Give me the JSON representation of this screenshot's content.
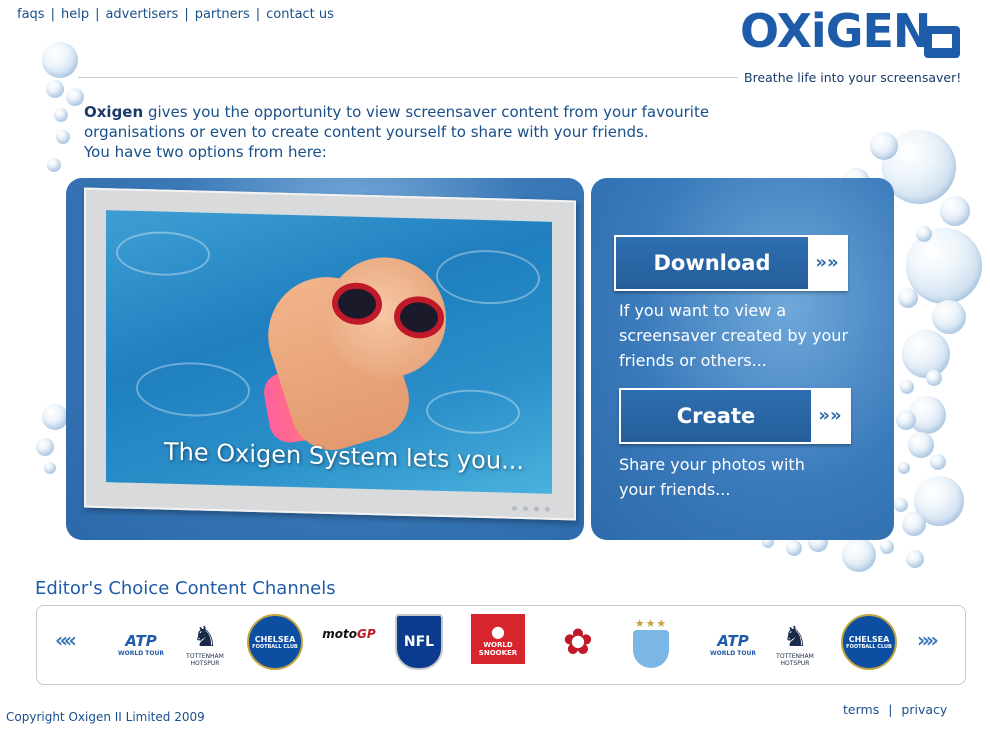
{
  "topnav": {
    "items": [
      "faqs",
      "help",
      "advertisers",
      "partners",
      "contact us"
    ],
    "separator": "|"
  },
  "logo": {
    "wordmark": "OXiGEN",
    "tagline": "Breathe life into your screensaver!"
  },
  "intro": {
    "brand": "Oxigen",
    "line1_rest": " gives you the opportunity to view screensaver content from your favourite",
    "line2": "organisations or even to create content yourself to share with your friends.",
    "line3": "You have two options from here:"
  },
  "feature": {
    "caption": "The Oxigen System lets you..."
  },
  "options": {
    "download": {
      "label": "Download",
      "arrow": "»»",
      "description": "If you want to view a screensaver created by your friends or others..."
    },
    "create": {
      "label": "Create",
      "arrow": "»»",
      "description": "Share your photos with your friends..."
    }
  },
  "channels": {
    "title": "Editor's Choice Content Channels",
    "prev": "«",
    "next": "»",
    "items": [
      {
        "name": "ATP",
        "sub": "WORLD TOUR"
      },
      {
        "name": "TOTTENHAM HOTSPUR"
      },
      {
        "name": "CHELSEA",
        "sub": "FOOTBALL CLUB"
      },
      {
        "name": "moto",
        "accent": "GP"
      },
      {
        "name": "NFL"
      },
      {
        "name": "WORLD SNOOKER"
      },
      {
        "name": "England Rugby"
      },
      {
        "name": "MCFC",
        "stars": "★★★"
      },
      {
        "name": "ATP",
        "sub": "WORLD TOUR"
      },
      {
        "name": "TOTTENHAM HOTSPUR"
      },
      {
        "name": "CHELSEA",
        "sub": "FOOTBALL CLUB"
      }
    ]
  },
  "footer": {
    "copyright": "Copyright Oxigen II Limited 2009",
    "links": [
      "terms",
      "privacy"
    ],
    "separator": "|"
  },
  "colors": {
    "brand_blue": "#1e5ba8",
    "panel_blue": "#2d6aa9",
    "text_blue": "#1a4f8a"
  }
}
